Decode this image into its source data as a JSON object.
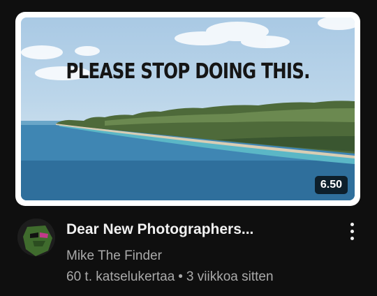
{
  "video": {
    "thumbnail_text": "PLEASE STOP DOING THIS.",
    "duration": "6.50",
    "title": "Dear New Photographers...",
    "channel": "Mike The Finder",
    "views": "60 t. katselukertaa",
    "separator": "•",
    "age": "3 viikkoa sitten"
  },
  "icons": {
    "menu": "more-vert-icon"
  },
  "colors": {
    "background": "#0f0f0f",
    "title": "#f1f1f1",
    "secondary": "#aaaaaa"
  }
}
